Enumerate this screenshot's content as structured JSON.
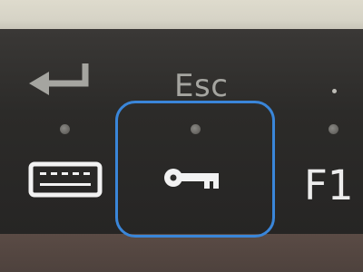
{
  "keys": {
    "enter": {
      "icon": "enter-arrow-icon"
    },
    "escape": {
      "label": "Esc"
    },
    "keyboard": {
      "icon": "keyboard-icon"
    },
    "key_lock": {
      "icon": "key-icon",
      "highlighted": true
    },
    "f1": {
      "label": "F1"
    }
  },
  "colors": {
    "panel": "#2f2c2a",
    "legend_text": "#a5a5a0",
    "icon_white": "#f2f2f2",
    "highlight_border": "#3a86d9",
    "led_off": "#6f6d69"
  }
}
